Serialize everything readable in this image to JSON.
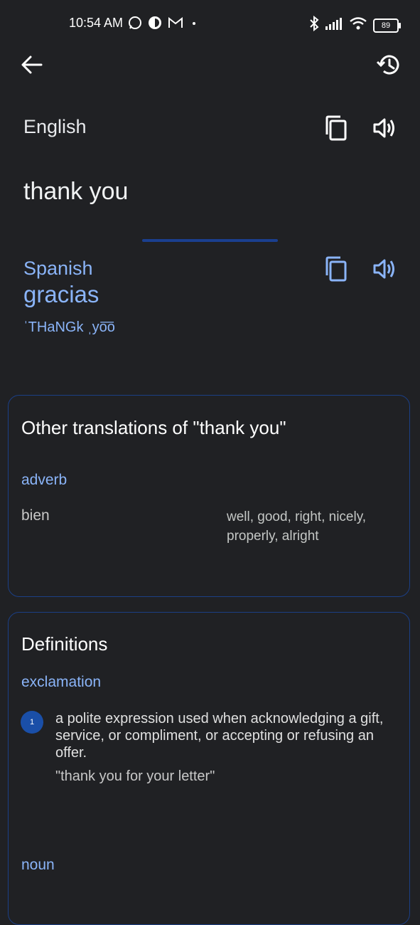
{
  "status_bar": {
    "time": "10:54 AM",
    "battery": "89",
    "left_icons": [
      "whatsapp-icon",
      "data-saver-icon",
      "gmail-icon",
      "dot-icon"
    ],
    "right_icons": [
      "bluetooth-icon",
      "signal-icon",
      "wifi-icon",
      "battery-icon"
    ]
  },
  "header": {
    "back_icon": "arrow-back-icon",
    "history_icon": "history-icon"
  },
  "source": {
    "language": "English",
    "text": "thank you"
  },
  "target": {
    "language": "Spanish",
    "text": "gracias",
    "phonetic": "ˈTHaNGk ˌyo͞o"
  },
  "other_translations": {
    "title": "Other translations of \"thank you\"",
    "part_of_speech": "adverb",
    "word": "bien",
    "meanings": "well, good, right, nicely, properly, alright"
  },
  "definitions": {
    "title": "Definitions",
    "groups": [
      {
        "part_of_speech": "exclamation",
        "items": [
          {
            "number": "1",
            "text": "a polite expression used when acknowledging a gift, service, or compliment, or accepting or refusing an offer.",
            "example": "\"thank you for your letter\""
          }
        ]
      },
      {
        "part_of_speech": "noun"
      }
    ]
  },
  "colors": {
    "background": "#202124",
    "accent": "#8ab4f8",
    "card_border": "#1b3f86",
    "badge": "#1a4fa8"
  }
}
